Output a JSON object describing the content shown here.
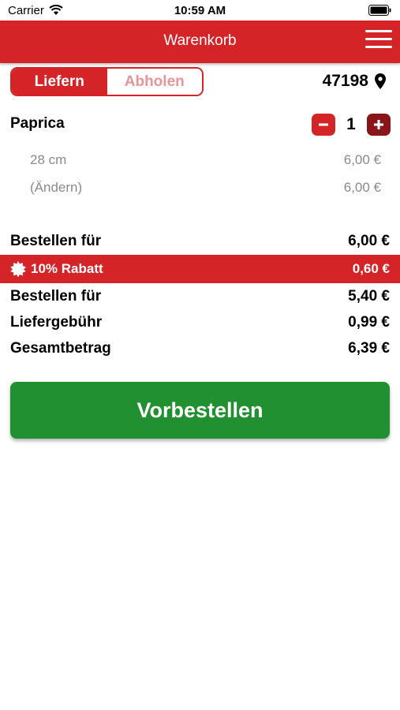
{
  "status_bar": {
    "carrier": "Carrier",
    "time": "10:59 AM"
  },
  "header": {
    "title": "Warenkorb"
  },
  "delivery_toggle": {
    "options": [
      "Liefern",
      "Abholen"
    ],
    "selected": "Liefern"
  },
  "location": {
    "zip": "47198"
  },
  "cart": {
    "item": {
      "name": "Paprica",
      "quantity": "1",
      "options": [
        {
          "label": "28 cm",
          "price": "6,00 €"
        },
        {
          "label": "(Ändern)",
          "price": "6,00 €"
        }
      ]
    }
  },
  "summary": {
    "subtotal_label": "Bestellen für",
    "subtotal_value": "6,00 €",
    "discount_label": "10% Rabatt",
    "discount_value": "0,60 €",
    "after_discount_label": "Bestellen für",
    "after_discount_value": "5,40 €",
    "delivery_fee_label": "Liefergebühr",
    "delivery_fee_value": "0,99 €",
    "total_label": "Gesamtbetrag",
    "total_value": "6,39 €"
  },
  "cta": {
    "label": "Vorbestellen"
  },
  "colors": {
    "brand_red": "#d42428",
    "dark_red": "#8a1518",
    "cta_green": "#219030",
    "muted_text": "#8a8a8a"
  }
}
